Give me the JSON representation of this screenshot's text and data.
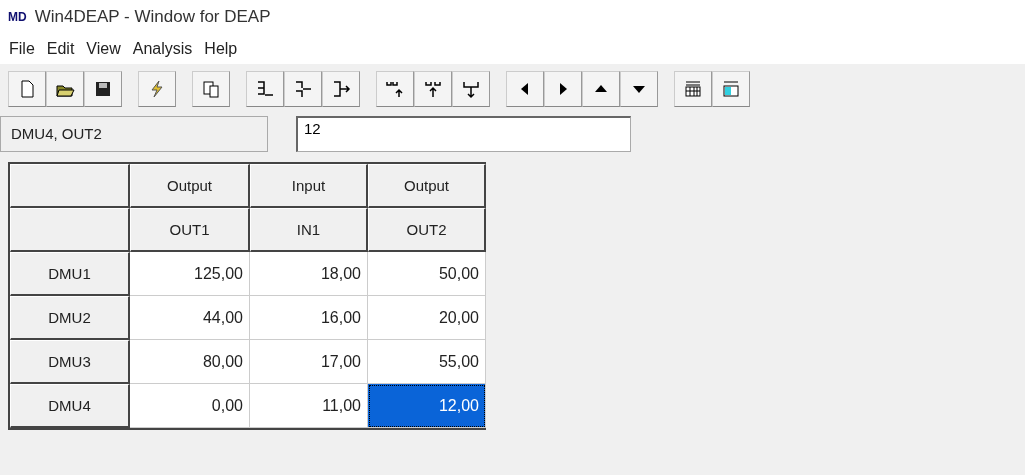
{
  "window": {
    "title": "Win4DEAP - Window for DEAP",
    "logo": "MD"
  },
  "menu": [
    "File",
    "Edit",
    "View",
    "Analysis",
    "Help"
  ],
  "cell_reference": "DMU4, OUT2",
  "cell_value": "12",
  "table": {
    "types": [
      "Output",
      "Input",
      "Output"
    ],
    "columns": [
      "OUT1",
      "IN1",
      "OUT2"
    ],
    "rows": [
      {
        "name": "DMU1",
        "cells": [
          {
            "value": "125,00",
            "selected": false
          },
          {
            "value": "18,00",
            "selected": false
          },
          {
            "value": "50,00",
            "selected": false
          }
        ]
      },
      {
        "name": "DMU2",
        "cells": [
          {
            "value": "44,00",
            "selected": false
          },
          {
            "value": "16,00",
            "selected": false
          },
          {
            "value": "20,00",
            "selected": false
          }
        ]
      },
      {
        "name": "DMU3",
        "cells": [
          {
            "value": "80,00",
            "selected": false
          },
          {
            "value": "17,00",
            "selected": false
          },
          {
            "value": "55,00",
            "selected": false
          }
        ]
      },
      {
        "name": "DMU4",
        "cells": [
          {
            "value": "0,00",
            "selected": false
          },
          {
            "value": "11,00",
            "selected": false
          },
          {
            "value": "12,00",
            "selected": true
          }
        ]
      }
    ]
  }
}
